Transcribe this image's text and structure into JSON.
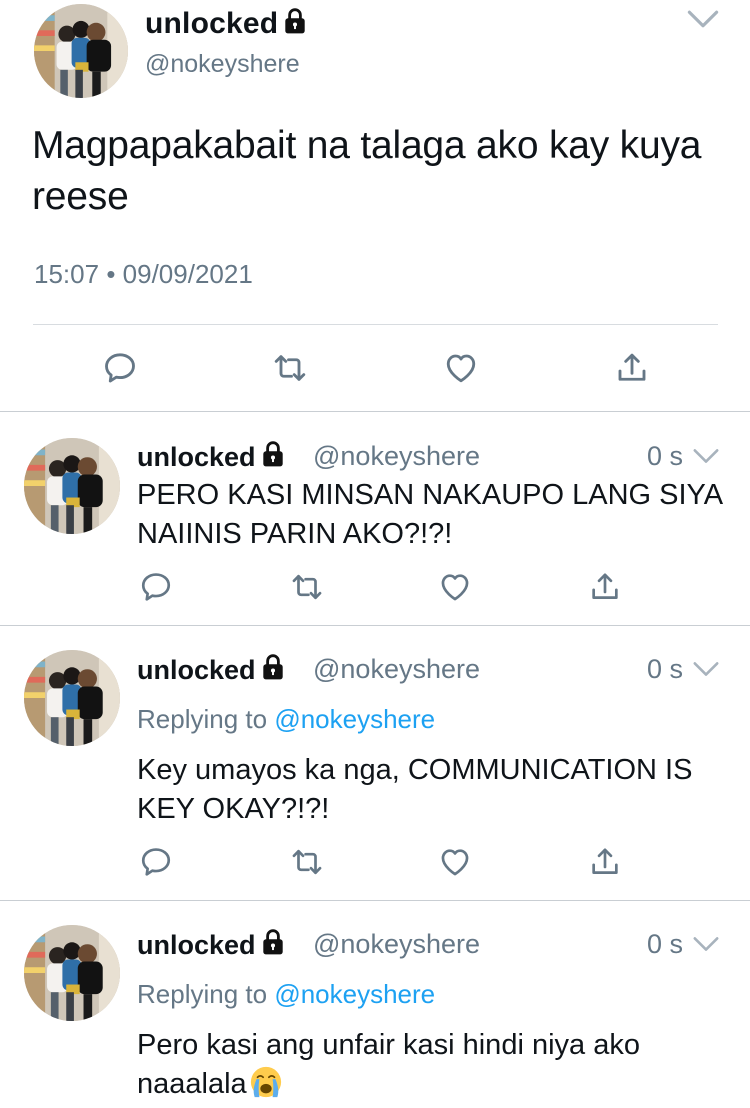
{
  "main_tweet": {
    "display_name": "unlocked",
    "handle": "@nokeyshere",
    "text": "Magpapakabait na talaga ako kay kuya reese",
    "time": "15:07",
    "separator": "•",
    "date": "09/09/2021"
  },
  "replies": [
    {
      "display_name": "unlocked",
      "handle": "@nokeyshere",
      "time": "0 s",
      "replying_prefix": "",
      "replying_to": "",
      "text": "PERO KASI MINSAN NAKAUPO LANG SIYA NAIINIS PARIN AKO?!?!"
    },
    {
      "display_name": "unlocked",
      "handle": "@nokeyshere",
      "time": "0 s",
      "replying_prefix": "Replying to",
      "replying_to": "@nokeyshere",
      "text": "Key umayos ka nga, COMMUNICATION IS KEY OKAY?!?!"
    },
    {
      "display_name": "unlocked",
      "handle": "@nokeyshere",
      "time": "0 s",
      "replying_prefix": "Replying to",
      "replying_to": "@nokeyshere",
      "text": "Pero kasi ang unfair kasi hindi niya ako naaalala"
    }
  ],
  "icons": {
    "reply": "reply-icon",
    "retweet": "retweet-icon",
    "like": "heart-icon",
    "share": "share-icon",
    "lock": "lock-icon",
    "menu": "chevron-down-icon",
    "emoji": "loudly-crying-face-icon"
  },
  "colors": {
    "text": "#0f1419",
    "secondary": "#657786",
    "link": "#1da1f2",
    "icon": "#657786",
    "divider": "#c9ced3"
  }
}
